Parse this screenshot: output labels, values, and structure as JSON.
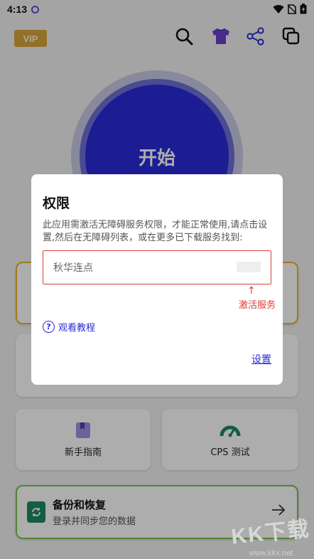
{
  "status_bar": {
    "time": "4:13",
    "icons": [
      "location-dot-icon",
      "wifi-icon",
      "no-sim-icon",
      "battery-icon"
    ]
  },
  "toolbar": {
    "vip_label": "VIP",
    "icons": [
      "search-icon",
      "tshirt-icon",
      "share-icon",
      "copy-icon"
    ]
  },
  "main": {
    "start_label": "开始"
  },
  "cards": {
    "guide_label": "新手指南",
    "cps_label": "CPS 测试",
    "backup_title": "备份和恢复",
    "backup_subtitle": "登录并同步您的数据"
  },
  "dialog": {
    "title": "权限",
    "message": "此应用需激活无障碍服务权限，才能正常使用,请点击设置,然后在无障碍列表，或在更多已下载服务找到:",
    "service_name": "秋华连点",
    "arrow": "↑",
    "activate_label": "激活服务",
    "help_label": "观看教程",
    "settings_label": "设置"
  },
  "watermark": {
    "text": "KK下载",
    "url": "www.kkx.net"
  },
  "colors": {
    "accent": "#2a2ad9",
    "vip": "#d9a63a",
    "warn": "#e23b2f",
    "backup_border": "#7ac24a"
  }
}
